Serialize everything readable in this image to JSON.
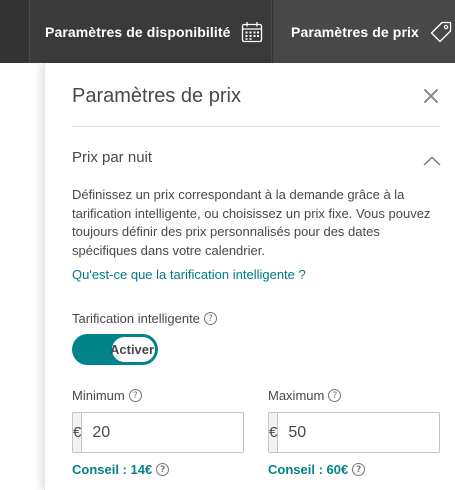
{
  "topbar": {
    "tabs": [
      {
        "label": "Paramètres de disponibilité",
        "icon": "calendar-icon"
      },
      {
        "label": "Paramètres de prix",
        "icon": "price-tag-icon"
      }
    ]
  },
  "panel": {
    "title": "Paramètres de prix",
    "close_icon": "close-icon",
    "section_title": "Prix par nuit",
    "section_icon": "chevron-up-icon",
    "description": "Définissez un prix correspondant à la demande grâce à la tarification intelligente, ou choisissez un prix fixe. Vous pouvez toujours définir des prix personnalisés pour des dates spécifiques dans votre calendrier.",
    "learn_link": "Qu'est-ce que la tarification intelligente ?",
    "smart_pricing": {
      "label": "Tarification intelligente",
      "help": "?",
      "toggle_label": "Activer",
      "enabled": true
    },
    "minimum": {
      "label": "Minimum",
      "help": "?",
      "currency": "€",
      "value": "20",
      "tip": "Conseil : 14€",
      "tip_help": "?"
    },
    "maximum": {
      "label": "Maximum",
      "help": "?",
      "currency": "€",
      "value": "50",
      "tip": "Conseil : 60€",
      "tip_help": "?"
    }
  },
  "colors": {
    "topbar_bg": "#333333",
    "accent": "#008489",
    "link": "#007a87",
    "text": "#484848"
  }
}
